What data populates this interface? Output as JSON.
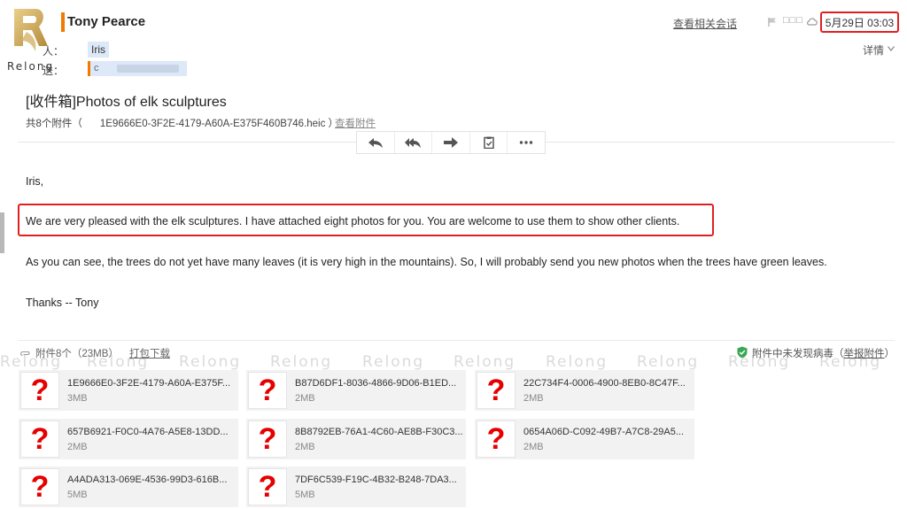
{
  "logo": {
    "text": "Relong"
  },
  "header": {
    "sender": "Tony Pearce",
    "related_link": "查看相关会话",
    "status_dots": "□□□",
    "date": "5月29日 03:03",
    "details": "详情",
    "to_label": "人：",
    "to_value": "Iris",
    "cc_label": "送：",
    "cc_value": "c"
  },
  "subject": "[收件箱]Photos of elk sculptures",
  "attachment_summary": {
    "prefix": "共8个附件（",
    "first_file": "1E9666E0-3F2E-4179-A60A-E375F460B746.heic ）",
    "view_link": "查看附件"
  },
  "toolbar": {
    "icons": [
      "reply-icon",
      "reply-all-icon",
      "forward-icon",
      "clipboard-icon",
      "more-icon"
    ]
  },
  "body": {
    "greeting": "Iris,",
    "paragraph1": "We are very pleased with the elk sculptures.  I have attached eight photos for you.  You are welcome to use them to show other clients.",
    "paragraph2": "As you can see, the trees do not yet have many leaves (it is very high in the mountains).  So, I will probably send you new photos when the trees have green leaves.",
    "signoff": "Thanks -- Tony"
  },
  "attachments_header": {
    "count": "附件8个（23MB）",
    "pack_download": "打包下载",
    "virus_status": "附件中未发现病毒（",
    "report_link": "举报附件",
    "close_paren": "）"
  },
  "watermark": "Relong",
  "attachments": [
    {
      "name": "1E9666E0-3F2E-4179-A60A-E375F...",
      "size": "3MB"
    },
    {
      "name": "B87D6DF1-8036-4866-9D06-B1ED...",
      "size": "2MB"
    },
    {
      "name": "22C734F4-0006-4900-8EB0-8C47F...",
      "size": "2MB"
    },
    {
      "name": "657B6921-F0C0-4A76-A5E8-13DD...",
      "size": "2MB"
    },
    {
      "name": "8B8792EB-76A1-4C60-AE8B-F30C3...",
      "size": "2MB"
    },
    {
      "name": "0654A06D-C092-49B7-A7C8-29A5...",
      "size": "2MB"
    },
    {
      "name": "A4ADA313-069E-4536-99D3-616B...",
      "size": "5MB"
    },
    {
      "name": "7DF6C539-F19C-4B32-B248-7DA3...",
      "size": "5MB"
    }
  ],
  "colors": {
    "accent_orange": "#f07b00",
    "highlight_red": "#e02020",
    "chip_blue": "#dde9f8",
    "thumb_red": "#e60000"
  }
}
